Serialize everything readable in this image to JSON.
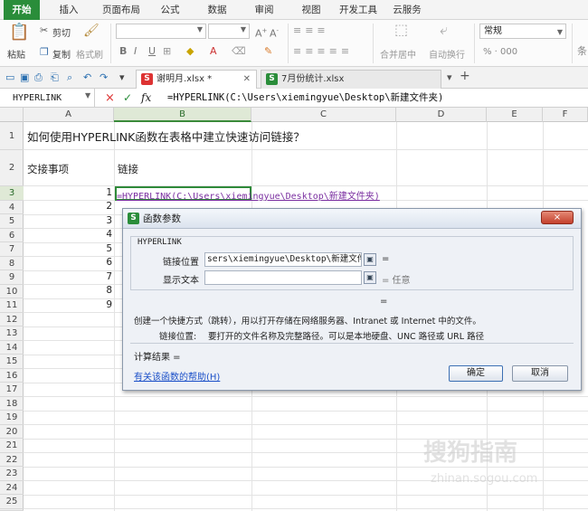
{
  "menu_tabs": [
    "开始",
    "插入",
    "页面布局",
    "公式",
    "数据",
    "审阅",
    "视图",
    "开发工具",
    "云服务"
  ],
  "ribbon": {
    "paste": "粘贴",
    "cut": "剪切",
    "copy": "复制",
    "format_painter": "格式刷",
    "merge_center": "合并居中",
    "wrap_text": "自动换行",
    "number_format": "常规",
    "percent_row": "% · 000",
    "font_bold": "B",
    "font_italic": "I",
    "font_underline": "U"
  },
  "doc_tabs": [
    {
      "label": "谢明月.xlsx *",
      "active": true
    },
    {
      "label": "7月份统计.xlsx",
      "active": false
    }
  ],
  "formula_bar": {
    "name_box": "HYPERLINK",
    "cancel": "×",
    "confirm": "✓",
    "fx": "fx",
    "content": "=HYPERLINK(C:\\Users\\xiemingyue\\Desktop\\新建文件夹)"
  },
  "columns": [
    "A",
    "B",
    "C",
    "D",
    "E",
    "F"
  ],
  "rows": [
    "1",
    "2",
    "3",
    "4",
    "5",
    "6",
    "7",
    "8",
    "9",
    "10",
    "11",
    "12",
    "13",
    "14",
    "15",
    "16",
    "17",
    "18",
    "19",
    "20",
    "21",
    "22",
    "23",
    "24",
    "25",
    "26"
  ],
  "cells": {
    "A1": "如何使用HYPERLINK函数在表格中建立快速访问链接？",
    "A2": "交接事项",
    "B2": "链接",
    "A3": "1",
    "A4": "2",
    "A5": "3",
    "A6": "4",
    "A7": "5",
    "A8": "6",
    "A9": "7",
    "A10": "8",
    "A11": "9",
    "B3": "=HYPERLINK(C:\\Users\\xiemingyue\\Desktop\\新建文件夹)"
  },
  "dialog": {
    "title": "函数参数",
    "close": "×",
    "function_name": "HYPERLINK",
    "arg1_label": "链接位置",
    "arg1_value": "sers\\xiemingyue\\Desktop\\新建文件夹",
    "arg1_result": "=",
    "arg2_label": "显示文本",
    "arg2_value": "",
    "arg2_result": "= 任意",
    "formula_result_eq": "=",
    "description": "创建一个快捷方式（跳转），用以打开存储在网络服务器、Intranet 或 Internet 中的文件。",
    "arg_help_label": "链接位置:",
    "arg_help_text": "要打开的文件名称及完整路径。可以是本地硬盘、UNC 路径或 URL 路径",
    "calc_result": "计算结果 =",
    "help_link": "有关该函数的帮助(H)",
    "ok": "确定",
    "cancel": "取消"
  },
  "watermark": "搜狗指南",
  "watermark_url": "zhinan.sogou.com"
}
